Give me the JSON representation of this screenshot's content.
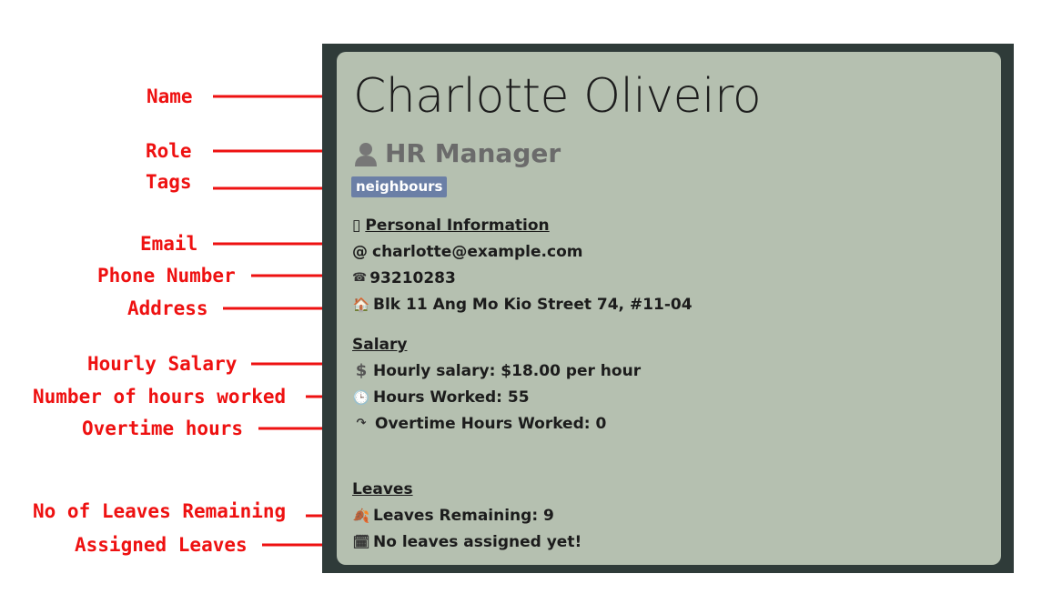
{
  "annotations": {
    "name": "Name",
    "role": "Role",
    "tags": "Tags",
    "email": "Email",
    "phone": "Phone Number",
    "address": "Address",
    "hourly_salary": "Hourly Salary",
    "hours_worked": "Number of hours worked",
    "overtime": "Overtime hours",
    "leaves_remaining": "No of Leaves Remaining",
    "assigned_leaves": "Assigned Leaves"
  },
  "card": {
    "name": "Charlotte Oliveiro",
    "role": "HR Manager",
    "tags": [
      "neighbours"
    ],
    "personal_heading_icon": "▯",
    "personal_heading": "Personal Information",
    "email_icon": "@",
    "email": "charlotte@example.com",
    "phone_icon": "☎",
    "phone": "93210283",
    "address_icon": "🏠",
    "address": "Blk 11 Ang Mo Kio Street 74, #11-04",
    "salary_heading": "Salary",
    "hourly_icon": "$",
    "hourly": "Hourly salary: $18.00 per hour",
    "hours_icon": "🕒",
    "hours": "Hours Worked: 55",
    "overtime_icon": "↷",
    "overtime": "Overtime Hours Worked: 0",
    "leaves_heading": "Leaves",
    "leaves_remaining_icon": "🍂",
    "leaves_remaining": "Leaves Remaining: 9",
    "assigned_icon": "🗓",
    "assigned": "No leaves assigned yet!"
  },
  "colors": {
    "annotation": "#ee1111",
    "frame": "#2f3b39",
    "card": "#b5c0b0",
    "tag": "#6b7fa6"
  },
  "icons": {
    "role": "person-icon",
    "personal": "id-card-icon",
    "email": "at-icon",
    "phone": "phone-icon",
    "address": "house-icon",
    "hourly": "dollar-icon",
    "hours": "clock-icon",
    "overtime": "redo-arrow-icon",
    "leaves": "leaves-icon",
    "assigned": "calendar-icon"
  }
}
